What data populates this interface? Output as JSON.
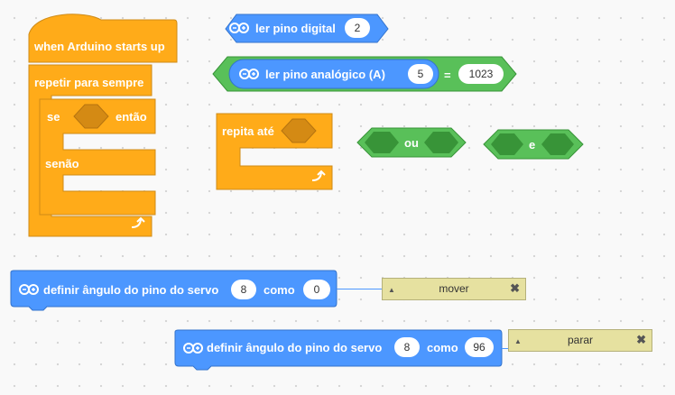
{
  "hat": {
    "label": "when Arduino starts up"
  },
  "forever": {
    "label": "repetir para sempre"
  },
  "if_else": {
    "if_label": "se",
    "then_label": "então",
    "else_label": "senão"
  },
  "read_digital": {
    "label": "ler pino digital",
    "pin": "2"
  },
  "read_analog": {
    "label": "ler pino analógico  (A)",
    "pin": "5",
    "operator": "=",
    "value": "1023"
  },
  "repeat_until": {
    "label": "repita até"
  },
  "or_block": {
    "label": "ou"
  },
  "and_block": {
    "label": "e"
  },
  "servo_1": {
    "label": "definir ângulo do pino do servo",
    "pin": "8",
    "as_label": "como",
    "angle": "0"
  },
  "servo_2": {
    "label": "definir ângulo do pino do servo",
    "pin": "8",
    "as_label": "como",
    "angle": "96"
  },
  "comment_1": {
    "text": "mover"
  },
  "comment_2": {
    "text": "parar"
  },
  "colors": {
    "control": "#ffab19",
    "control_dark": "#cf8b17",
    "arduino": "#4c97ff",
    "arduino_dark": "#3373cc",
    "operator": "#59c059",
    "operator_dark": "#389438",
    "comment": "#e6e1a0"
  }
}
